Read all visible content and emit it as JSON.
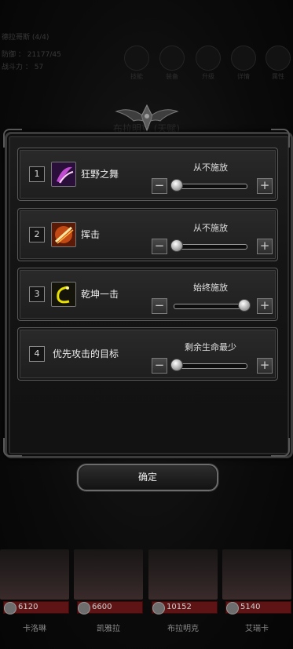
{
  "background": {
    "info_lines": [
      "德拉哥斯 (4/4)",
      "防御 ： 21177/45",
      "战斗力 ： 57"
    ],
    "nav_items": [
      "技能",
      "装备",
      "升级",
      "详情",
      "属性"
    ],
    "title": "布拉明克 (天赋)"
  },
  "skills": [
    {
      "number": "1",
      "name": "狂野之舞",
      "mode": "从不施放",
      "level": 0,
      "icon": "wild-dance-icon"
    },
    {
      "number": "2",
      "name": "挥击",
      "mode": "从不施放",
      "level": 0,
      "icon": "slash-icon"
    },
    {
      "number": "3",
      "name": "乾坤一击",
      "mode": "始终施放",
      "level": 1,
      "icon": "heaven-earth-strike-icon"
    },
    {
      "number": "4",
      "name": "优先攻击的目标",
      "mode": "剩余生命最少",
      "level": 0
    }
  ],
  "controls": {
    "minus": "−",
    "plus": "+"
  },
  "confirm_label": "确定",
  "heroes": [
    {
      "name": "卡洛琳",
      "hp": "6120"
    },
    {
      "name": "凯雅拉",
      "hp": "6600"
    },
    {
      "name": "布拉明克",
      "hp": "10152"
    },
    {
      "name": "艾瑞卡",
      "hp": "5140"
    }
  ],
  "colors": {
    "hp_bar": "#5e1414",
    "knob": "#d0d0d0",
    "frame": "#3b3b3b"
  }
}
